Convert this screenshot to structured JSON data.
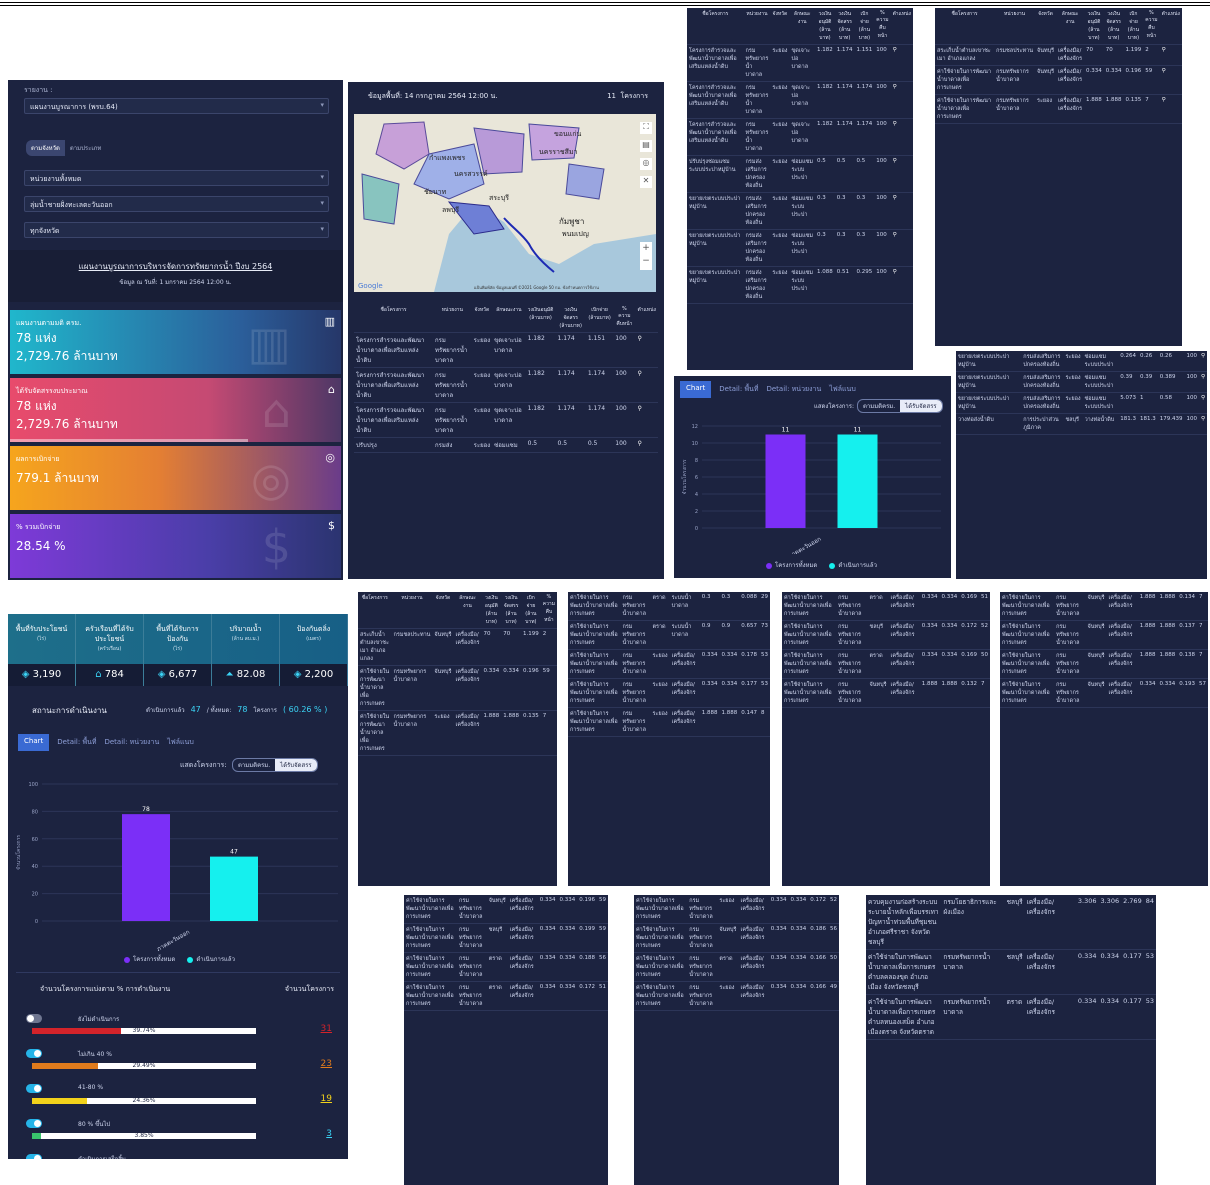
{
  "left_form": {
    "report_label": "รายงาน :",
    "report_value": "แผนงานบูรณาการ (พรบ.64)",
    "toggle_on": "ตามจังหวัด",
    "toggle_off": "ตามประเภท",
    "agency_value": "หน่วยงานทั้งหมด",
    "basin_value": "ลุ่มน้ำชายฝั่งทะเลตะวันออก",
    "province_value": "ทุกจังหวัด",
    "plan_title": "แผนงานบูรณาการบริหารจัดการทรัพยากรน้ำ ปีงบ 2564",
    "plan_date": "ข้อมูล ณ วันที่: 1 มกราคม 2564 12:00 น."
  },
  "kpis": [
    {
      "title": "แผนงานตามมติ ครม.",
      "line1": "78 แห่ง",
      "line2": "2,729.76 ล้านบาท",
      "icon": "chart-icon",
      "color": "#2bb3c8"
    },
    {
      "title": "ได้รับจัดสรรงบประมาณ",
      "line1": "78 แห่ง",
      "line2": "2,729.76 ล้านบาท",
      "icon": "bank-icon",
      "color": "#e0536e"
    },
    {
      "title": "ผลการเบิกจ่าย",
      "line1": "779.1 ล้านบาท",
      "line2": "",
      "icon": "coins-icon",
      "color": "#f3a21f"
    },
    {
      "title": "% รวมเบิกจ่าย",
      "line1": "28.54 %",
      "line2": "",
      "icon": "hand-money-icon",
      "color": "#7b3fd6"
    }
  ],
  "map_panel": {
    "date_label": "ข้อมูลพื้นที่:",
    "date_value": "14 กรกฎาคม 2564 12:00 น.",
    "count": "11",
    "count_unit": "โครงการ",
    "map_labels": [
      "กำแพงเพชร",
      "นครสวรรค์",
      "ชัยนาท",
      "นครราชสีมา",
      "ขอนแก่น",
      "สระบุรี",
      "ลพบุรี",
      "กัมพูชา",
      "พนมเปญ"
    ],
    "google": "Google",
    "attribution": "แป้นพิมพ์ลัด  ข้อมูลแผนที่ ©2021 Google  50 กม.  ข้อกำหนดการใช้งาน"
  },
  "table_headers": [
    "ชื่อโครงการ",
    "หน่วยงาน",
    "จังหวัด",
    "ลักษณะงาน",
    "วงเงินอนุมัติ (ล้านบาท)",
    "วงเงินจัดสรร (ล้านบาท)",
    "เบิกจ่าย (ล้านบาท)",
    "% ความคืบหน้า",
    "ตำแหน่ง"
  ],
  "map_table_rows": [
    [
      "โครงการสำรวจและพัฒนาน้ำบาดาลเพื่อเสริมแหล่งน้ำดิบ",
      "กรมทรัพยากรน้ำบาดาล",
      "ระยอง",
      "ขุดเจาะบ่อบาดาล",
      "1.182",
      "1.174",
      "1.151",
      "100"
    ],
    [
      "โครงการสำรวจและพัฒนาน้ำบาดาลเพื่อเสริมแหล่งน้ำดิบ",
      "กรมทรัพยากรน้ำบาดาล",
      "ระยอง",
      "ขุดเจาะบ่อบาดาล",
      "1.182",
      "1.174",
      "1.174",
      "100"
    ],
    [
      "โครงการสำรวจและพัฒนาน้ำบาดาลเพื่อเสริมแหล่งน้ำดิบ",
      "กรมทรัพยากรน้ำบาดาล",
      "ระยอง",
      "ขุดเจาะบ่อบาดาล",
      "1.182",
      "1.174",
      "1.174",
      "100"
    ],
    [
      "ปรับปรุง",
      "กรมส่ง",
      "ระยอง",
      "ซ่อมแซม",
      "0.5",
      "0.5",
      "0.5",
      "100"
    ]
  ],
  "tr_table_rows": [
    [
      "โครงการสำรวจและพัฒนาน้ำบาดาลเพื่อเสริมแหล่งน้ำดิบ",
      "กรมทรัพยากรน้ำบาดาล",
      "ระยอง",
      "ขุดเจาะบ่อบาดาล",
      "1.182",
      "1.174",
      "1.151",
      "100"
    ],
    [
      "โครงการสำรวจและพัฒนาน้ำบาดาลเพื่อเสริมแหล่งน้ำดิบ",
      "กรมทรัพยากรน้ำบาดาล",
      "ระยอง",
      "ขุดเจาะบ่อบาดาล",
      "1.182",
      "1.174",
      "1.174",
      "100"
    ],
    [
      "โครงการสำรวจและพัฒนาน้ำบาดาลเพื่อเสริมแหล่งน้ำดิบ",
      "กรมทรัพยากรน้ำบาดาล",
      "ระยอง",
      "ขุดเจาะบ่อบาดาล",
      "1.182",
      "1.174",
      "1.174",
      "100"
    ],
    [
      "ปรับปรุงซ่อมแซมระบบประปาหมู่บ้าน",
      "กรมส่งเสริมการปกครองท้องถิ่น",
      "ระยอง",
      "ซ่อมแซมระบบประปา",
      "0.5",
      "0.5",
      "0.5",
      "100"
    ],
    [
      "ขยายเขตระบบประปาหมู่บ้าน",
      "กรมส่งเสริมการปกครองท้องถิ่น",
      "ระยอง",
      "ซ่อมแซมระบบประปา",
      "0.3",
      "0.3",
      "0.3",
      "100"
    ],
    [
      "ขยายเขตระบบประปาหมู่บ้าน",
      "กรมส่งเสริมการปกครองท้องถิ่น",
      "ระยอง",
      "ซ่อมแซมระบบประปา",
      "0.3",
      "0.3",
      "0.3",
      "100"
    ],
    [
      "ขยายเขตระบบประปาหมู่บ้าน",
      "กรมส่งเสริมการปกครองท้องถิ่น",
      "ระยอง",
      "ซ่อมแซมระบบประปา",
      "1.088",
      "0.51",
      "0.295",
      "100"
    ]
  ],
  "far_table_rows": [
    [
      "สระเก็บน้ำตำบลเขาชะเมา อำเภอแกลง",
      "กรมชลประทาน",
      "จันทบุรี",
      "เครื่องมือ/เครื่องจักร",
      "70",
      "70",
      "1.199",
      "2"
    ],
    [
      "ค่าใช้จ่ายในการพัฒนาน้ำบาดาลเพื่อการเกษตร",
      "กรมทรัพยากรน้ำบาดาล",
      "จันทบุรี",
      "เครื่องมือ/เครื่องจักร",
      "0.334",
      "0.334",
      "0.196",
      "59"
    ],
    [
      "ค่าใช้จ่ายในการพัฒนาน้ำบาดาลเพื่อการเกษตร",
      "กรมทรัพยากรน้ำบาดาล",
      "ระยอง",
      "เครื่องมือ/เครื่องจักร",
      "1.888",
      "1.888",
      "0.135",
      "7"
    ]
  ],
  "mid_right_rows": [
    [
      "ขยายเขตระบบประปาหมู่บ้าน",
      "กรมส่งเสริมการปกครองท้องถิ่น",
      "ระยอง",
      "ซ่อมแซมระบบประปา",
      "0.264",
      "0.26",
      "0.26",
      "100"
    ],
    [
      "ขยายเขตระบบประปาหมู่บ้าน",
      "กรมส่งเสริมการปกครองท้องถิ่น",
      "ระยอง",
      "ซ่อมแซมระบบประปา",
      "0.39",
      "0.39",
      "0.389",
      "100"
    ],
    [
      "ขยายเขตระบบประปาหมู่บ้าน",
      "กรมส่งเสริมการปกครองท้องถิ่น",
      "ระยอง",
      "ซ่อมแซมระบบประปา",
      "5.073",
      "1",
      "0.58",
      "100"
    ],
    [
      "วางท่อส่งน้ำดิบ",
      "การประปาส่วนภูมิภาค",
      "ชลบุรี",
      "วางท่อน้ำดิบ",
      "181.3",
      "181.3",
      "179.439",
      "100"
    ]
  ],
  "small_chart": {
    "tabs": [
      "Chart",
      "Detail: พื้นที่",
      "Detail: หน่วยงาน",
      "ไฟล์แนบ"
    ],
    "show_label": "แสดงโครงการ:",
    "seg": [
      "ตามมติครม.",
      "ได้รับจัดสรร"
    ]
  },
  "stats": [
    {
      "title": "พื้นที่รับประโยชน์",
      "unit": "(ไร่)",
      "value": "3,190",
      "icon": "layers-icon"
    },
    {
      "title": "ครัวเรือนที่ได้รับประโยชน์",
      "unit": "(ครัวเรือน)",
      "value": "784",
      "icon": "home-icon"
    },
    {
      "title": "พื้นที่ได้รับการป้องกัน",
      "unit": "(ไร่)",
      "value": "6,677",
      "icon": "layers-icon"
    },
    {
      "title": "ปริมาณน้ำ",
      "unit": "(ล้าน ลบ.ม.)",
      "value": "82.08",
      "icon": "water-icon"
    },
    {
      "title": "ป้องกันตลิ่ง",
      "unit": "(เมตร)",
      "value": "2,200",
      "icon": "layers-icon"
    }
  ],
  "status": {
    "title": "สถานะการดำเนินงาน",
    "done_label": "ดำเนินการแล้ว",
    "done": "47",
    "total_label": "/ ทั้งหมด:",
    "total": "78",
    "unit": "โครงการ",
    "pct": "( 60.26 % )"
  },
  "progress": {
    "title": "จำนวนโครงการแบ่งตาม % การดำเนินงาน",
    "right_title": "จำนวนโครงการ",
    "rows": [
      {
        "label": "ยังไม่ดำเนินการ",
        "pct_text": "39.74%",
        "fill": 0.3974,
        "color": "#d3232a",
        "count": "31",
        "on": false
      },
      {
        "label": "ไม่เกิน 40 %",
        "pct_text": "29.49%",
        "fill": 0.2949,
        "color": "#e07b1c",
        "count": "23",
        "on": true
      },
      {
        "label": "41-80 %",
        "pct_text": "24.36%",
        "fill": 0.2436,
        "color": "#f2d21b",
        "count": "19",
        "on": true
      },
      {
        "label": "80 % ขึ้นไป",
        "pct_text": "3.85%",
        "fill": 0.0385,
        "color": "#39c36d",
        "count": "3",
        "on": true
      },
      {
        "label": "ดำเนินการเสร็จสิ้น",
        "pct_text": "",
        "fill": 0,
        "color": "#39c36d",
        "count": "",
        "on": true
      }
    ]
  },
  "chart_data": [
    {
      "type": "bar",
      "categories": [
        "ภาคตะวันออก"
      ],
      "series": [
        {
          "name": "โครงการทั้งหมด",
          "values": [
            78
          ],
          "color": "#7b2ff7"
        },
        {
          "name": "ดำเนินการแล้ว",
          "values": [
            47
          ],
          "color": "#15f0ee"
        }
      ],
      "ylabel": "จำนวนโครงการ",
      "ylim": [
        0,
        100
      ],
      "yticks": [
        "0",
        "20",
        "40",
        "60",
        "80",
        "100"
      ]
    },
    {
      "type": "bar",
      "categories": [
        "ภาคตะวันออก"
      ],
      "series": [
        {
          "name": "โครงการทั้งหมด",
          "values": [
            11
          ],
          "color": "#7b2ff7"
        },
        {
          "name": "ดำเนินการแล้ว",
          "values": [
            11
          ],
          "color": "#15f0ee"
        }
      ],
      "ylabel": "จำนวนโครงการ",
      "ylim": [
        0,
        12
      ],
      "yticks": [
        "0",
        "2",
        "4",
        "6",
        "8",
        "10",
        "12"
      ]
    }
  ],
  "gallery_rows_a": [
    [
      "ค่าใช้จ่ายในการพัฒนาน้ำบาดาลเพื่อการเกษตร",
      "กรมทรัพยากรน้ำบาดาล",
      "ตราด",
      "ระบบน้ำบาดาล",
      "0.3",
      "0.3",
      "0.088",
      "29"
    ],
    [
      "ค่าใช้จ่ายในการพัฒนาน้ำบาดาลเพื่อการเกษตร",
      "กรมทรัพยากรน้ำบาดาล",
      "ตราด",
      "ระบบน้ำบาดาล",
      "0.9",
      "0.9",
      "0.657",
      "73"
    ],
    [
      "ค่าใช้จ่ายในการพัฒนาน้ำบาดาลเพื่อการเกษตร",
      "กรมทรัพยากรน้ำบาดาล",
      "ระยอง",
      "เครื่องมือ/เครื่องจักร",
      "0.334",
      "0.334",
      "0.178",
      "53"
    ],
    [
      "ค่าใช้จ่ายในการพัฒนาน้ำบาดาลเพื่อการเกษตร",
      "กรมทรัพยากรน้ำบาดาล",
      "ระยอง",
      "เครื่องมือ/เครื่องจักร",
      "0.334",
      "0.334",
      "0.177",
      "53"
    ],
    [
      "ค่าใช้จ่ายในการพัฒนาน้ำบาดาลเพื่อการเกษตร",
      "กรมทรัพยากรน้ำบาดาล",
      "ระยอง",
      "เครื่องมือ/เครื่องจักร",
      "1.888",
      "1.888",
      "0.147",
      "8"
    ]
  ],
  "gallery_rows_b": [
    [
      "ค่าใช้จ่ายในการพัฒนาน้ำบาดาลเพื่อการเกษตร",
      "กรมทรัพยากรน้ำบาดาล",
      "ตราด",
      "เครื่องมือ/เครื่องจักร",
      "0.334",
      "0.334",
      "0.169",
      "51"
    ],
    [
      "ค่าใช้จ่ายในการพัฒนาน้ำบาดาลเพื่อการเกษตร",
      "กรมทรัพยากรน้ำบาดาล",
      "ชลบุรี",
      "เครื่องมือ/เครื่องจักร",
      "0.334",
      "0.334",
      "0.172",
      "52"
    ],
    [
      "ค่าใช้จ่ายในการพัฒนาน้ำบาดาลเพื่อการเกษตร",
      "กรมทรัพยากรน้ำบาดาล",
      "ตราด",
      "เครื่องมือ/เครื่องจักร",
      "0.334",
      "0.334",
      "0.169",
      "50"
    ],
    [
      "ค่าใช้จ่ายในการพัฒนาน้ำบาดาลเพื่อการเกษตร",
      "กรมทรัพยากรน้ำบาดาล",
      "จันทบุรี",
      "เครื่องมือ/เครื่องจักร",
      "1.888",
      "1.888",
      "0.132",
      "7"
    ]
  ],
  "gallery_rows_c": [
    [
      "ค่าใช้จ่ายในการพัฒนาน้ำบาดาลเพื่อการเกษตร",
      "กรมทรัพยากรน้ำบาดาล",
      "จันทบุรี",
      "เครื่องมือ/เครื่องจักร",
      "1.888",
      "1.888",
      "0.134",
      "7"
    ],
    [
      "ค่าใช้จ่ายในการพัฒนาน้ำบาดาลเพื่อการเกษตร",
      "กรมทรัพยากรน้ำบาดาล",
      "จันทบุรี",
      "เครื่องมือ/เครื่องจักร",
      "1.888",
      "1.888",
      "0.137",
      "7"
    ],
    [
      "ค่าใช้จ่ายในการพัฒนาน้ำบาดาลเพื่อการเกษตร",
      "กรมทรัพยากรน้ำบาดาล",
      "จันทบุรี",
      "เครื่องมือ/เครื่องจักร",
      "1.888",
      "1.888",
      "0.138",
      "7"
    ],
    [
      "ค่าใช้จ่ายในการพัฒนาน้ำบาดาลเพื่อการเกษตร",
      "กรมทรัพยากรน้ำบาดาล",
      "จันทบุรี",
      "เครื่องมือ/เครื่องจักร",
      "0.334",
      "0.334",
      "0.193",
      "57"
    ]
  ],
  "gallery_rows_d": [
    [
      "ค่าใช้จ่ายในการพัฒนาน้ำบาดาลเพื่อการเกษตร",
      "กรมทรัพยากรน้ำบาดาล",
      "จันทบุรี",
      "เครื่องมือ/เครื่องจักร",
      "0.334",
      "0.334",
      "0.196",
      "59"
    ],
    [
      "ค่าใช้จ่ายในการพัฒนาน้ำบาดาลเพื่อการเกษตร",
      "กรมทรัพยากรน้ำบาดาล",
      "ชลบุรี",
      "เครื่องมือ/เครื่องจักร",
      "0.334",
      "0.334",
      "0.199",
      "59"
    ],
    [
      "ค่าใช้จ่ายในการพัฒนาน้ำบาดาลเพื่อการเกษตร",
      "กรมทรัพยากรน้ำบาดาล",
      "ตราด",
      "เครื่องมือ/เครื่องจักร",
      "0.334",
      "0.334",
      "0.188",
      "56"
    ],
    [
      "ค่าใช้จ่ายในการพัฒนาน้ำบาดาลเพื่อการเกษตร",
      "กรมทรัพยากรน้ำบาดาล",
      "ตราด",
      "เครื่องมือ/เครื่องจักร",
      "0.334",
      "0.334",
      "0.172",
      "51"
    ]
  ],
  "gallery_rows_e": [
    [
      "ค่าใช้จ่ายในการพัฒนาน้ำบาดาลเพื่อการเกษตร",
      "กรมทรัพยากรน้ำบาดาล",
      "ระยอง",
      "เครื่องมือ/เครื่องจักร",
      "0.334",
      "0.334",
      "0.172",
      "52"
    ],
    [
      "ค่าใช้จ่ายในการพัฒนาน้ำบาดาลเพื่อการเกษตร",
      "กรมทรัพยากรน้ำบาดาล",
      "จันทบุรี",
      "เครื่องมือ/เครื่องจักร",
      "0.334",
      "0.334",
      "0.186",
      "56"
    ],
    [
      "ค่าใช้จ่ายในการพัฒนาน้ำบาดาลเพื่อการเกษตร",
      "กรมทรัพยากรน้ำบาดาล",
      "ตราด",
      "เครื่องมือ/เครื่องจักร",
      "0.334",
      "0.334",
      "0.166",
      "50"
    ],
    [
      "ค่าใช้จ่ายในการพัฒนาน้ำบาดาลเพื่อการเกษตร",
      "กรมทรัพยากรน้ำบาดาล",
      "ระยอง",
      "เครื่องมือ/เครื่องจักร",
      "0.334",
      "0.334",
      "0.166",
      "49"
    ]
  ],
  "gallery_rows_f": [
    [
      "ควบคุมงานก่อสร้างระบบระบายน้ำหลักเพื่อบรรเทาปัญหาน้ำท่วมพื้นที่ชุมชนอำเภอศรีราชา จังหวัดชลบุรี",
      "กรมโยธาธิการและผังเมือง",
      "ชลบุรี",
      "เครื่องมือ/เครื่องจักร",
      "3.306",
      "3.306",
      "2.769",
      "84"
    ],
    [
      "ค่าใช้จ่ายในการพัฒนาน้ำบาดาลเพื่อการเกษตร ตำบลคลองขุด อำเภอเมือง จังหวัดชลบุรี",
      "กรมทรัพยากรน้ำบาดาล",
      "ชลบุรี",
      "เครื่องมือ/เครื่องจักร",
      "0.334",
      "0.334",
      "0.177",
      "53"
    ],
    [
      "ค่าใช้จ่ายในการพัฒนาน้ำบาดาลเพื่อการเกษตร ตำบลหนองเสม็ด อำเภอเมืองตราด จังหวัดตราด",
      "กรมทรัพยากรน้ำบาดาล",
      "ตราด",
      "เครื่องมือ/เครื่องจักร",
      "0.334",
      "0.334",
      "0.177",
      "53"
    ]
  ]
}
